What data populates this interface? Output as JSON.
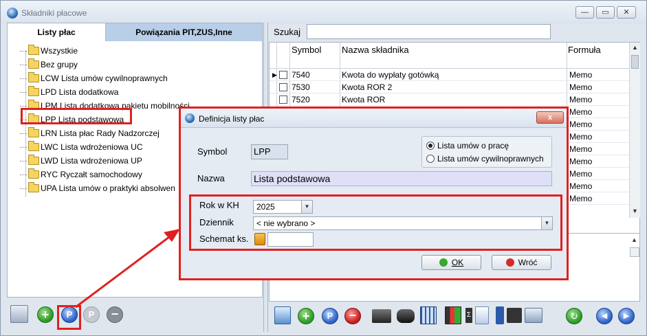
{
  "window": {
    "title": "Składniki płacowe"
  },
  "left": {
    "tabs": [
      "Listy płac",
      "Powiązania PIT,ZUS,Inne"
    ],
    "tree": [
      "Wszystkie",
      "Bez grupy",
      "LCW Lista umów cywilnoprawnych",
      "LPD Lista dodatkowa",
      "LPM Lista dodatkowa pakietu mobilności",
      "LPP Lista podstawowa",
      "LRN Lista płac Rady Nadzorczej",
      "LWC Lista wdrożeniowa UC",
      "LWD Lista wdrożeniowa UP",
      "RYC Ryczałt samochodowy",
      "UPA Lista umów o praktyki absolwen"
    ]
  },
  "right": {
    "search_label": "Szukaj",
    "search_value": "",
    "columns": [
      "Symbol",
      "Nazwa składnika",
      "Formuła"
    ],
    "rows": [
      {
        "symbol": "7540",
        "name": "Kwota do wypłaty gotówką",
        "formula": "Memo"
      },
      {
        "symbol": "7530",
        "name": "Kwota ROR 2",
        "formula": "Memo"
      },
      {
        "symbol": "7520",
        "name": "Kwota ROR",
        "formula": "Memo"
      },
      {
        "symbol": "",
        "name": "",
        "formula": "Memo"
      },
      {
        "symbol": "",
        "name": "",
        "formula": "Memo"
      },
      {
        "symbol": "",
        "name": "",
        "formula": "Memo"
      },
      {
        "symbol": "",
        "name": "",
        "formula": "Memo"
      },
      {
        "symbol": "",
        "name": "",
        "formula": "Memo"
      },
      {
        "symbol": "",
        "name": "",
        "formula": "Memo"
      },
      {
        "symbol": "",
        "name": "",
        "formula": "Memo"
      },
      {
        "symbol": "",
        "name": "",
        "formula": "Memo"
      }
    ]
  },
  "dialog": {
    "title": "Definicja listy płac",
    "close_glyph": "x",
    "symbol_label": "Symbol",
    "symbol_value": "LPP",
    "radio_options": [
      "Lista umów o pracę",
      "Lista umów cywilnoprawnych"
    ],
    "radio_selected": 0,
    "nazwa_label": "Nazwa",
    "nazwa_value": "Lista podstawowa",
    "rok_label": "Rok w KH",
    "rok_value": "2025",
    "dziennik_label": "Dziennik",
    "dziennik_value": "< nie wybrano >",
    "schemat_label": "Schemat ks.",
    "schemat_value": "",
    "ok_label": "OK",
    "cancel_label": "Wróć"
  },
  "colors": {
    "highlight": "#e02020",
    "accent": "#2f6fb6",
    "tab_inactive": "#b9cfe8"
  }
}
